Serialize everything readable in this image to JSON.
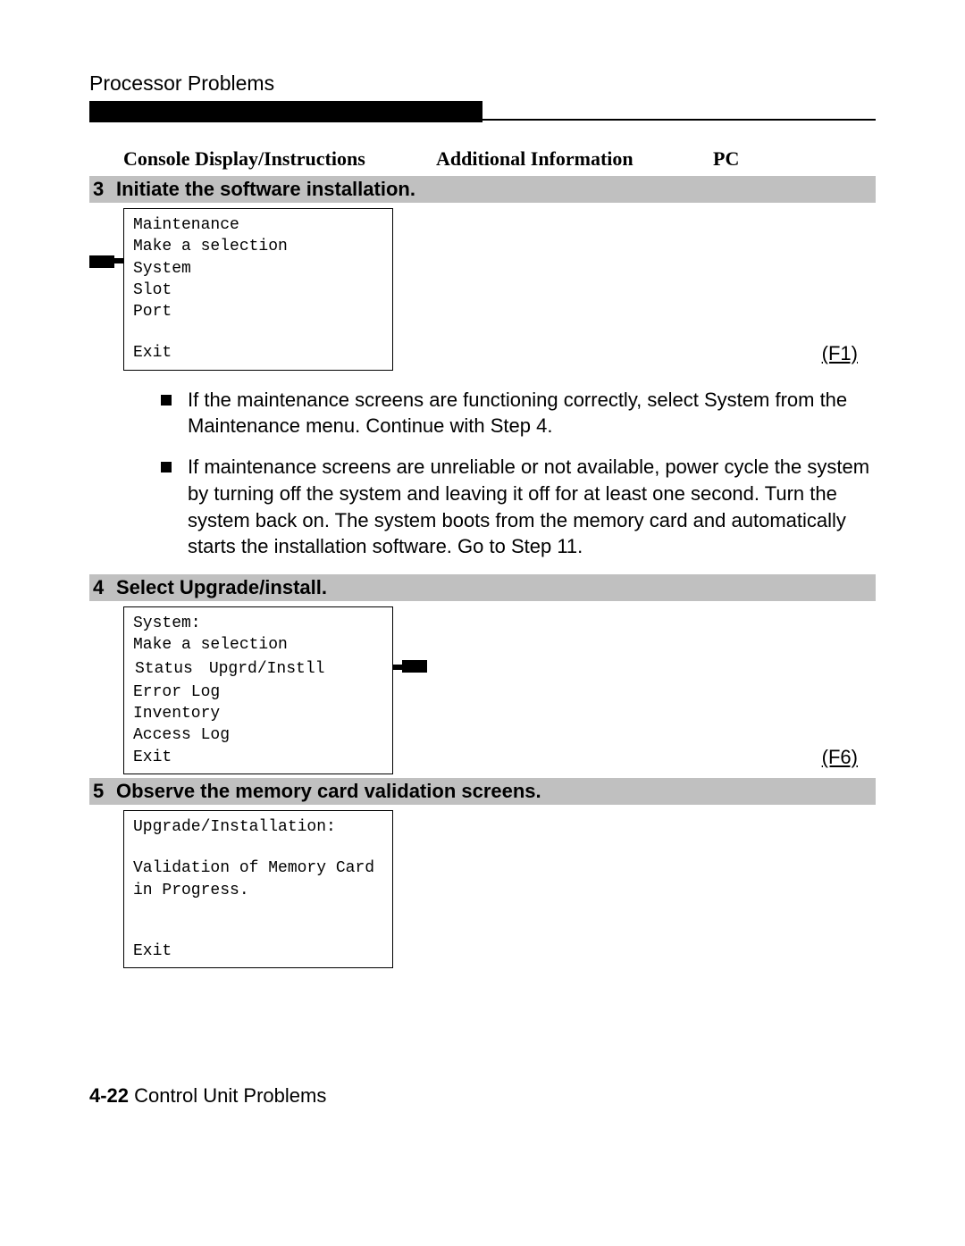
{
  "header": {
    "title": "Processor Problems"
  },
  "columns": {
    "console": "Console Display/Instructions",
    "additional": "Additional Information",
    "pc": "PC"
  },
  "steps": {
    "s3": {
      "num": "3",
      "title": "Initiate the software installation."
    },
    "s4": {
      "num": "4",
      "title": "Select Upgrade/install."
    },
    "s5": {
      "num": "5",
      "title": "Observe the memory card validation screens."
    }
  },
  "console1": {
    "l1": "Maintenance",
    "l2": "Make a selection",
    "l3": "System",
    "l4": "Slot",
    "l5": "Port",
    "exit": "Exit"
  },
  "pc1": "(F1)",
  "bullets": {
    "b1": "If the maintenance screens are functioning correctly, select System from the Maintenance menu. Continue with Step 4.",
    "b2": "If maintenance screens are unreliable or not available, power cycle the system by turning off the system and leaving it off for at least one second. Turn the system back on. The system boots from the memory card and automatically starts the installation software. Go to Step 11."
  },
  "console2": {
    "l1": "System:",
    "l2": "Make a selection",
    "r3a": "Status",
    "r3b": "Upgrd/Instll",
    "l4": "Error Log",
    "l5": "Inventory",
    "l6": "Access Log",
    "exit": "Exit"
  },
  "pc2": "(F6)",
  "console3": {
    "l1": "Upgrade/Installation:",
    "l2": "Validation of Memory Card",
    "l3": "in Progress.",
    "exit": "Exit"
  },
  "footer": {
    "bold": "4-22",
    "rest": " Control Unit Problems"
  }
}
